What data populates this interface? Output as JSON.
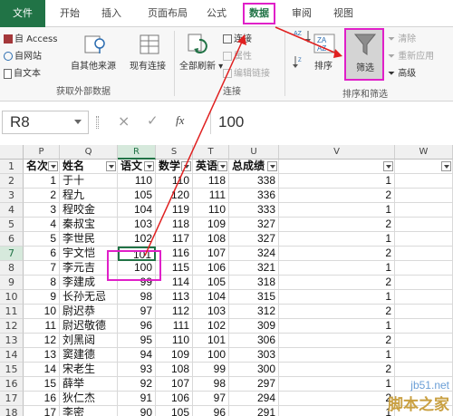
{
  "tabs": [
    {
      "label": "文件"
    },
    {
      "label": "开始"
    },
    {
      "label": "插入"
    },
    {
      "label": "页面布局"
    },
    {
      "label": "公式"
    },
    {
      "label": "数据"
    },
    {
      "label": "审阅"
    },
    {
      "label": "视图"
    }
  ],
  "ribbon": {
    "external": {
      "access": "自 Access",
      "web": "自网站",
      "text": "自文本",
      "other": "自其他来源",
      "existing": "现有连接",
      "group_label": "获取外部数据"
    },
    "connections": {
      "refresh_all": "全部刷新",
      "connections": "连接",
      "properties": "属性",
      "edit_links": "编辑链接",
      "group_label": "连接"
    },
    "sortfilter": {
      "sort": "排序",
      "filter": "筛选",
      "clear": "清除",
      "reapply": "重新应用",
      "advanced": "高级",
      "group_label": "排序和筛选"
    }
  },
  "formula_bar": {
    "name_box": "R8",
    "cancel": "×",
    "confirm": "✓",
    "fx": "fx",
    "value": "100"
  },
  "columns": [
    "P",
    "Q",
    "R",
    "S",
    "T",
    "U",
    "V",
    "W"
  ],
  "rows": [
    "1",
    "2",
    "3",
    "4",
    "5",
    "6",
    "7",
    "8",
    "9",
    "10",
    "11",
    "12",
    "13",
    "14",
    "15",
    "16",
    "17",
    "18"
  ],
  "header_row": {
    "p": "名次",
    "q": "姓名",
    "r": "语文",
    "s": "数学",
    "t": "英语",
    "u": "总成绩"
  },
  "table": [
    {
      "p": "1",
      "q": "于十",
      "r": "110",
      "s": "110",
      "t": "118",
      "u": "338",
      "v": "1"
    },
    {
      "p": "2",
      "q": "程九",
      "r": "105",
      "s": "120",
      "t": "111",
      "u": "336",
      "v": "2"
    },
    {
      "p": "3",
      "q": "程咬金",
      "r": "104",
      "s": "119",
      "t": "110",
      "u": "333",
      "v": "1"
    },
    {
      "p": "4",
      "q": "秦叔宝",
      "r": "103",
      "s": "118",
      "t": "109",
      "u": "327",
      "v": "2"
    },
    {
      "p": "5",
      "q": "李世民",
      "r": "102",
      "s": "117",
      "t": "108",
      "u": "327",
      "v": "1"
    },
    {
      "p": "6",
      "q": "宇文恺",
      "r": "101",
      "s": "116",
      "t": "107",
      "u": "324",
      "v": "2"
    },
    {
      "p": "7",
      "q": "李元吉",
      "r": "100",
      "s": "115",
      "t": "106",
      "u": "321",
      "v": "1"
    },
    {
      "p": "8",
      "q": "李建成",
      "r": "99",
      "s": "114",
      "t": "105",
      "u": "318",
      "v": "2"
    },
    {
      "p": "9",
      "q": "长孙无忌",
      "r": "98",
      "s": "113",
      "t": "104",
      "u": "315",
      "v": "1"
    },
    {
      "p": "10",
      "q": "尉迟恭",
      "r": "97",
      "s": "112",
      "t": "103",
      "u": "312",
      "v": "2"
    },
    {
      "p": "11",
      "q": "尉迟敬德",
      "r": "96",
      "s": "111",
      "t": "102",
      "u": "309",
      "v": "1"
    },
    {
      "p": "12",
      "q": "刘黑闼",
      "r": "95",
      "s": "110",
      "t": "101",
      "u": "306",
      "v": "2"
    },
    {
      "p": "13",
      "q": "窦建德",
      "r": "94",
      "s": "109",
      "t": "100",
      "u": "303",
      "v": "1"
    },
    {
      "p": "14",
      "q": "宋老生",
      "r": "93",
      "s": "108",
      "t": "99",
      "u": "300",
      "v": "2"
    },
    {
      "p": "15",
      "q": "薛举",
      "r": "92",
      "s": "107",
      "t": "98",
      "u": "297",
      "v": "1"
    },
    {
      "p": "16",
      "q": "狄仁杰",
      "r": "91",
      "s": "106",
      "t": "97",
      "u": "294",
      "v": "2"
    },
    {
      "p": "17",
      "q": "李密",
      "r": "90",
      "s": "105",
      "t": "96",
      "u": "291",
      "v": "1"
    }
  ],
  "watermark": {
    "line1": "jb51.net",
    "line2": "脚本之家"
  },
  "colors": {
    "accent": "#217346",
    "highlight": "#e020c8",
    "arrow": "#e02020"
  }
}
